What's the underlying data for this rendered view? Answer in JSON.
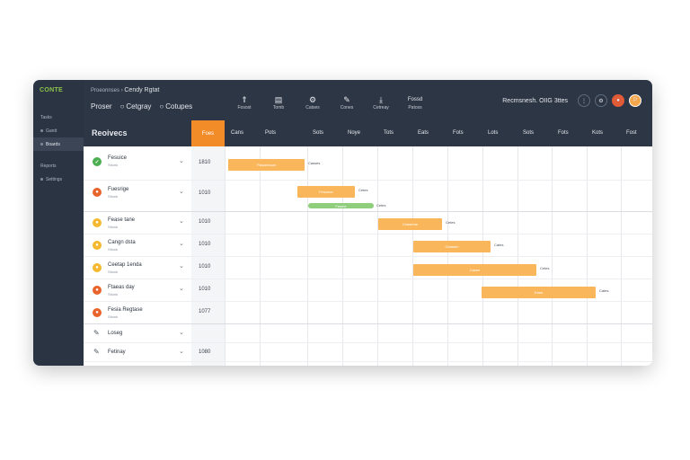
{
  "sidebar": {
    "logo": "CONTE",
    "items": [
      {
        "label": "Tasks",
        "active": false
      },
      {
        "label": "Gantt",
        "active": false
      },
      {
        "label": "Boards",
        "active": true
      },
      {
        "label": "Reports",
        "active": false
      },
      {
        "label": "Settings",
        "active": false
      }
    ]
  },
  "topbar": {
    "breadcrumb_root": "Proeonnses",
    "breadcrumb_sep": "›",
    "breadcrumb_current": "Cendy Rgtat",
    "project_items": [
      "Proser",
      "Cetgray",
      "Cotupes"
    ],
    "tools": [
      {
        "icon": "⇑",
        "label": "Fosost"
      },
      {
        "icon": "▤",
        "label": "Tomb"
      },
      {
        "icon": "⚙",
        "label": "Catses"
      },
      {
        "icon": "✎",
        "label": "Cones"
      },
      {
        "icon": "⤓",
        "label": "Cetreay"
      },
      {
        "icon": "Fossd",
        "label": "Patoss"
      }
    ],
    "right_title": "Recmsnesh. OIIG 3ttes"
  },
  "header": {
    "label": "Reoivecs",
    "today_col": "Foes",
    "columns": [
      "Cans",
      "Pots",
      "Sots",
      "Noye",
      "Tots",
      "Eats",
      "Fots",
      "Lots",
      "Sots",
      "Fots",
      "Kots",
      "Fost"
    ]
  },
  "rows": [
    {
      "status": "green",
      "name": "Fesuice",
      "sub": "Stiunk",
      "date": "1810"
    },
    {
      "status": "orange-red",
      "name": "Fuesrige",
      "sub": "Stiunk",
      "date": "1010"
    },
    {
      "status": "yellow",
      "name": "Fease tane",
      "sub": "Stiunk",
      "date": "1010"
    },
    {
      "status": "yellow",
      "name": "Cangn dsta",
      "sub": "Stiunk",
      "date": "1010"
    },
    {
      "status": "yellow",
      "name": "Ceetap 1enda",
      "sub": "Stiunk",
      "date": "1010"
    },
    {
      "status": "orange-red",
      "name": "Ftaeas day",
      "sub": "Stiunk",
      "date": "1010"
    },
    {
      "status": "orange-red",
      "name": "Fesia Regtase",
      "sub": "Stiunk",
      "date": "1077"
    },
    {
      "status": "pencil",
      "name": "Loseg",
      "sub": "",
      "date": ""
    },
    {
      "status": "pencil",
      "name": "Fetinay",
      "sub": "",
      "date": "1080"
    }
  ],
  "bars": [
    {
      "label": "Pasumeson",
      "note": "Casses"
    },
    {
      "label": "Fesumer",
      "note": "Cetes"
    },
    {
      "label": "Fesme",
      "note": "Cetes"
    },
    {
      "label": "Ceaseme",
      "note": "Cetes"
    },
    {
      "label": "Cetasen",
      "note": "Cates"
    },
    {
      "label": "Casee",
      "note": "Cetes"
    },
    {
      "label": "Ease",
      "note": "Cates"
    }
  ],
  "colors": {
    "accent": "#f28c28",
    "bar": "#f9b65b",
    "bar_green": "#8fce7b",
    "dark": "#2d3645",
    "status_green": "#4caf50",
    "status_orange_red": "#e8642c",
    "status_yellow": "#f5b82e"
  }
}
